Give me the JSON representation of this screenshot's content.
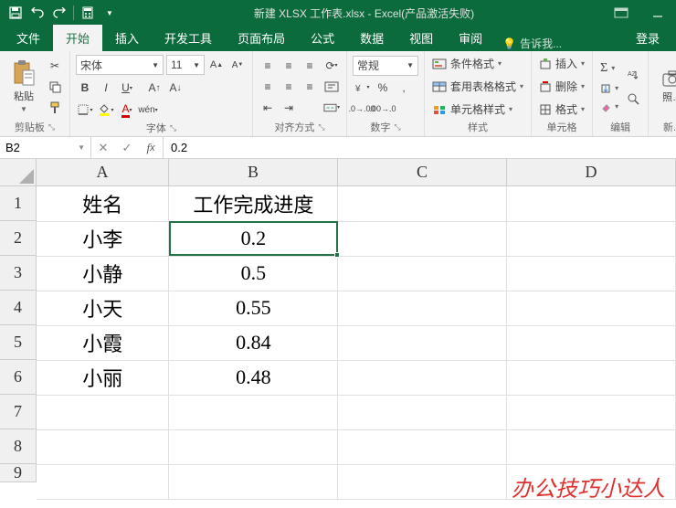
{
  "title": "新建 XLSX 工作表.xlsx - Excel(产品激活失败)",
  "tabs": {
    "file": "文件",
    "home": "开始",
    "insert": "插入",
    "dev": "开发工具",
    "layout": "页面布局",
    "formulas": "公式",
    "data": "数据",
    "view": "视图",
    "review": "审阅",
    "tellme": "告诉我...",
    "login": "登录"
  },
  "ribbon": {
    "clipboard": {
      "paste": "粘贴",
      "label": "剪贴板"
    },
    "font": {
      "name": "宋体",
      "size": "11",
      "label": "字体"
    },
    "align": {
      "label": "对齐方式"
    },
    "number": {
      "format": "常规",
      "label": "数字"
    },
    "styles": {
      "cond": "条件格式",
      "table": "套用表格格式",
      "cell": "单元格样式",
      "label": "样式"
    },
    "cells": {
      "insert": "插入",
      "delete": "删除",
      "format": "格式",
      "label": "单元格"
    },
    "editing": {
      "label": "编辑"
    },
    "addons": {
      "label": "新..."
    }
  },
  "formula_bar": {
    "cell_ref": "B2",
    "value": "0.2"
  },
  "columns": [
    "A",
    "B",
    "C",
    "D"
  ],
  "row_numbers": [
    1,
    2,
    3,
    4,
    5,
    6,
    7,
    8,
    9
  ],
  "sheet": {
    "headers": {
      "name": "姓名",
      "progress": "工作完成进度"
    },
    "rows": [
      {
        "name": "小李",
        "progress": "0.2"
      },
      {
        "name": "小静",
        "progress": "0.5"
      },
      {
        "name": "小天",
        "progress": "0.55"
      },
      {
        "name": "小霞",
        "progress": "0.84"
      },
      {
        "name": "小丽",
        "progress": "0.48"
      }
    ]
  },
  "watermark": "办公技巧小达人",
  "chart_data": {
    "type": "table",
    "title": "",
    "columns": [
      "姓名",
      "工作完成进度"
    ],
    "rows": [
      [
        "小李",
        0.2
      ],
      [
        "小静",
        0.5
      ],
      [
        "小天",
        0.55
      ],
      [
        "小霞",
        0.84
      ],
      [
        "小丽",
        0.48
      ]
    ]
  }
}
